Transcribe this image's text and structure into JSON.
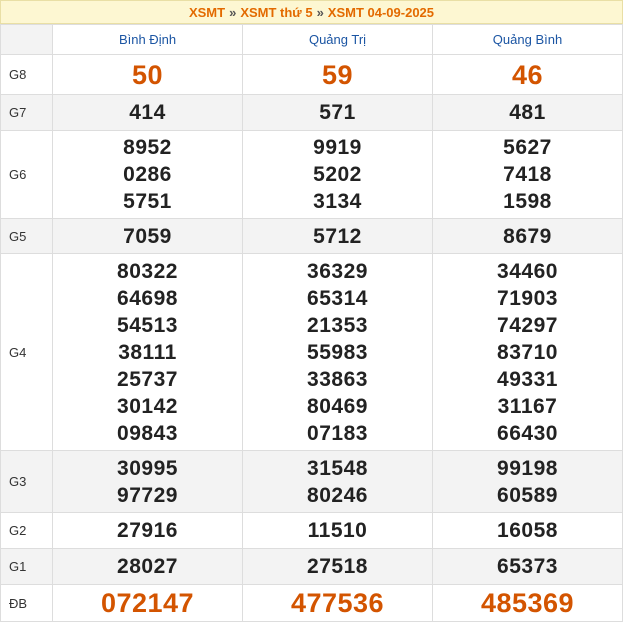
{
  "breadcrumb": {
    "item1": "XSMT",
    "item2": "XSMT thứ 5",
    "item3": "XSMT 04-09-2025",
    "separator": "»"
  },
  "columns": [
    "Bình Định",
    "Quảng Trị",
    "Quảng Bình"
  ],
  "rows": [
    {
      "label": "G8",
      "values": [
        [
          "50"
        ],
        [
          "59"
        ],
        [
          "46"
        ]
      ]
    },
    {
      "label": "G7",
      "values": [
        [
          "414"
        ],
        [
          "571"
        ],
        [
          "481"
        ]
      ]
    },
    {
      "label": "G6",
      "values": [
        [
          "8952",
          "0286",
          "5751"
        ],
        [
          "9919",
          "5202",
          "3134"
        ],
        [
          "5627",
          "7418",
          "1598"
        ]
      ]
    },
    {
      "label": "G5",
      "values": [
        [
          "7059"
        ],
        [
          "5712"
        ],
        [
          "8679"
        ]
      ]
    },
    {
      "label": "G4",
      "values": [
        [
          "80322",
          "64698",
          "54513",
          "38111",
          "25737",
          "30142",
          "09843"
        ],
        [
          "36329",
          "65314",
          "21353",
          "55983",
          "33863",
          "80469",
          "07183"
        ],
        [
          "34460",
          "71903",
          "74297",
          "83710",
          "49331",
          "31167",
          "66430"
        ]
      ]
    },
    {
      "label": "G3",
      "values": [
        [
          "30995",
          "97729"
        ],
        [
          "31548",
          "80246"
        ],
        [
          "99198",
          "60589"
        ]
      ]
    },
    {
      "label": "G2",
      "values": [
        [
          "27916"
        ],
        [
          "11510"
        ],
        [
          "16058"
        ]
      ]
    },
    {
      "label": "G1",
      "values": [
        [
          "28027"
        ],
        [
          "27518"
        ],
        [
          "65373"
        ]
      ]
    },
    {
      "label": "ĐB",
      "values": [
        [
          "072147"
        ],
        [
          "477536"
        ],
        [
          "485369"
        ]
      ]
    }
  ],
  "colors": {
    "accent": "#d35400",
    "header_text": "#1b55a3",
    "breadcrumb_bg": "#fdf7d2"
  }
}
